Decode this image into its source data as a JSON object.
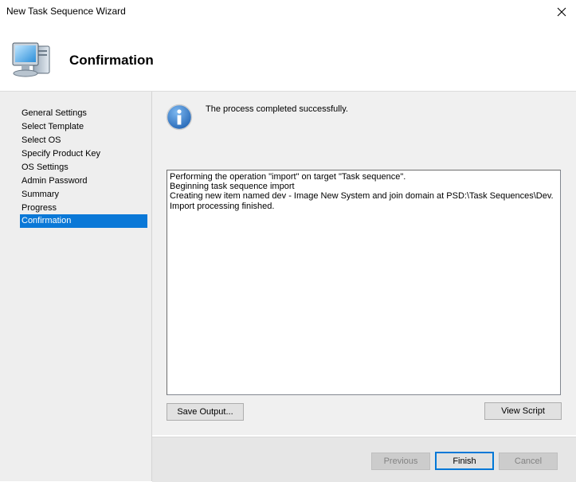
{
  "window": {
    "title": "New Task Sequence Wizard",
    "close_icon": "close-icon"
  },
  "header": {
    "title": "Confirmation",
    "icon": "computer-icon"
  },
  "sidebar": {
    "items": [
      {
        "label": "General Settings",
        "active": false
      },
      {
        "label": "Select Template",
        "active": false
      },
      {
        "label": "Select OS",
        "active": false
      },
      {
        "label": "Specify Product Key",
        "active": false
      },
      {
        "label": "OS Settings",
        "active": false
      },
      {
        "label": "Admin Password",
        "active": false
      },
      {
        "label": "Summary",
        "active": false
      },
      {
        "label": "Progress",
        "active": false
      },
      {
        "label": "Confirmation",
        "active": true
      }
    ]
  },
  "main": {
    "status_icon": "info-icon",
    "status_message": "The process completed successfully.",
    "output_lines": [
      "Performing the operation \"import\" on target \"Task sequence\".",
      "Beginning task sequence import",
      "Creating new item named dev - Image New System and join domain at PSD:\\Task Sequences\\Dev.",
      "Import processing finished."
    ],
    "save_output_label": "Save Output...",
    "view_script_label": "View Script"
  },
  "footer": {
    "previous_label": "Previous",
    "finish_label": "Finish",
    "cancel_label": "Cancel"
  },
  "colors": {
    "accent": "#0a78d7",
    "sidebar_bg": "#eeeeee",
    "content_bg": "#f0f0f0"
  }
}
